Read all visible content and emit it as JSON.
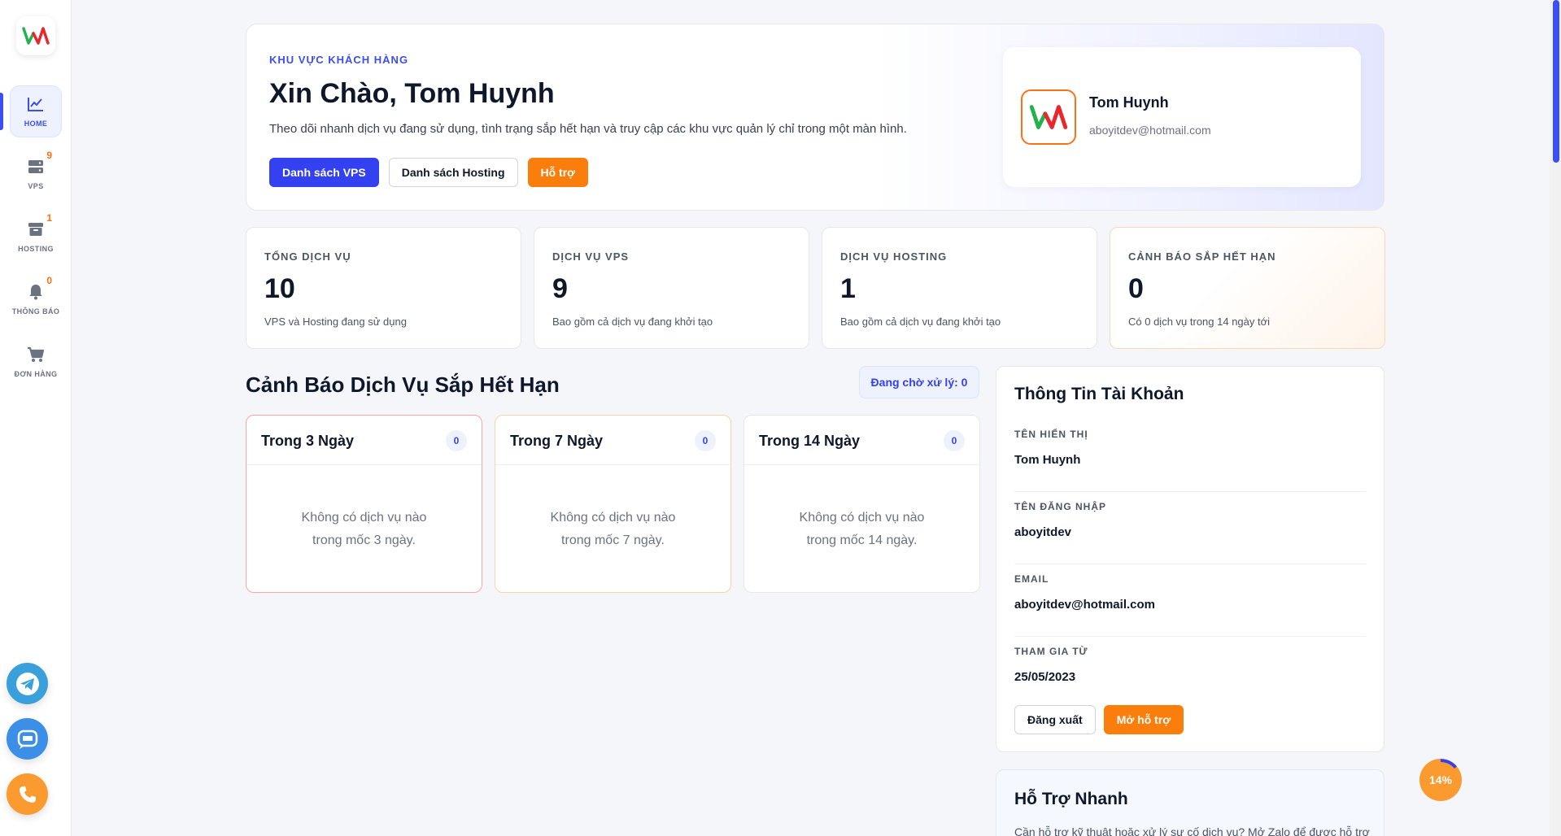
{
  "sidebar": {
    "items": [
      {
        "label": "HOME",
        "icon": "chart-line-icon",
        "badge": null,
        "active": true
      },
      {
        "label": "VPS",
        "icon": "server-icon",
        "badge": "9",
        "active": false
      },
      {
        "label": "HOSTING",
        "icon": "archive-box-icon",
        "badge": "1",
        "active": false
      },
      {
        "label": "THÔNG BÁO",
        "icon": "bell-icon",
        "badge": "0",
        "active": false
      },
      {
        "label": "ĐƠN HÀNG",
        "icon": "cart-icon",
        "badge": null,
        "active": false
      }
    ],
    "floating": [
      {
        "name": "telegram",
        "icon": "telegram-icon",
        "color": "#3aa0dc"
      },
      {
        "name": "zalo",
        "icon": "zalo-icon",
        "color": "#3b8fe6"
      },
      {
        "name": "phone",
        "icon": "phone-icon",
        "color": "#fb9a2f"
      }
    ]
  },
  "hero": {
    "eyebrow": "KHU VỰC KHÁCH HÀNG",
    "title": "Xin Chào, Tom Huynh",
    "description": "Theo dõi nhanh dịch vụ đang sử dụng, tình trạng sắp hết hạn và truy cập các khu vực quản lý chỉ trong một màn hình.",
    "actions": {
      "vps": "Danh sách VPS",
      "hosting": "Danh sách Hosting",
      "support": "Hỗ trợ"
    }
  },
  "profile": {
    "name": "Tom Huynh",
    "email": "aboyitdev@hotmail.com"
  },
  "stats": [
    {
      "label": "TỔNG DỊCH VỤ",
      "value": "10",
      "desc": "VPS và Hosting đang sử dụng"
    },
    {
      "label": "DỊCH VỤ VPS",
      "value": "9",
      "desc": "Bao gồm cả dịch vụ đang khởi tạo"
    },
    {
      "label": "DỊCH VỤ HOSTING",
      "value": "1",
      "desc": "Bao gồm cả dịch vụ đang khởi tạo"
    },
    {
      "label": "CẢNH BÁO SẮP HẾT HẠN",
      "value": "0",
      "desc": "Có 0 dịch vụ trong 14 ngày tới"
    }
  ],
  "warnings": {
    "title": "Cảnh Báo Dịch Vụ Sắp Hết Hạn",
    "pending": "Đang chờ xử lý: 0",
    "cards": [
      {
        "title": "Trong 3 Ngày",
        "count": "0",
        "empty_line1": "Không có dịch vụ nào",
        "empty_line2": "trong mốc 3 ngày."
      },
      {
        "title": "Trong 7 Ngày",
        "count": "0",
        "empty_line1": "Không có dịch vụ nào",
        "empty_line2": "trong mốc 7 ngày."
      },
      {
        "title": "Trong 14 Ngày",
        "count": "0",
        "empty_line1": "Không có dịch vụ nào",
        "empty_line2": "trong mốc 14 ngày."
      }
    ]
  },
  "account": {
    "title": "Thông Tin Tài Khoản",
    "fields": [
      {
        "label": "TÊN HIỂN THỊ",
        "value": "Tom Huynh"
      },
      {
        "label": "TÊN ĐĂNG NHẬP",
        "value": "aboyitdev"
      },
      {
        "label": "EMAIL",
        "value": "aboyitdev@hotmail.com"
      },
      {
        "label": "THAM GIA TỪ",
        "value": "25/05/2023"
      }
    ],
    "logout": "Đăng xuất",
    "open_support": "Mở hỗ trợ"
  },
  "quick_support": {
    "title": "Hỗ Trợ Nhanh",
    "description": "Cần hỗ trợ kỹ thuật hoặc xử lý sự cố dịch vụ? Mở Zalo để được hỗ trợ"
  },
  "progress": {
    "label": "14%",
    "percent": 14
  },
  "colors": {
    "primary": "#3341f0",
    "accent": "#fb7d0b",
    "badge": "#f97316"
  }
}
